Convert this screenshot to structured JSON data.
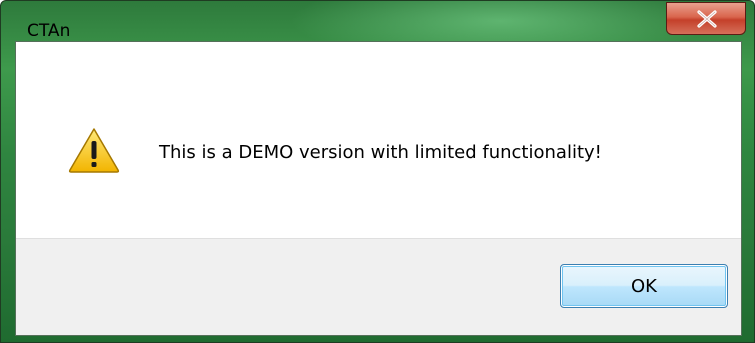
{
  "window": {
    "title": "CTAn"
  },
  "title_bar": {
    "close_icon": "close-icon"
  },
  "dialog": {
    "icon": "warning-icon",
    "message": "This is a DEMO version with limited functionality!",
    "ok_label": "OK"
  },
  "colors": {
    "frame_green": "#2f8540",
    "close_red": "#c4402a",
    "button_blue": "#a7d9f5"
  }
}
